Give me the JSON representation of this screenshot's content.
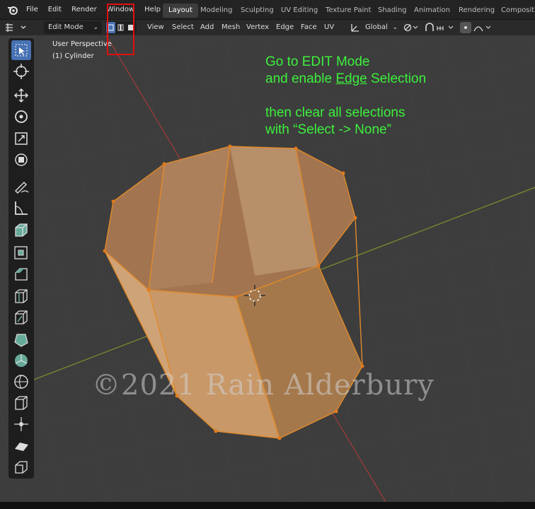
{
  "menu": [
    "File",
    "Edit",
    "Render",
    "Window",
    "Help"
  ],
  "workspaces": [
    "Layout",
    "Modeling",
    "Sculpting",
    "UV Editing",
    "Texture Paint",
    "Shading",
    "Animation",
    "Rendering",
    "Compositing"
  ],
  "mode_select": "Edit Mode",
  "view_menus": [
    "View",
    "Select",
    "Add",
    "Mesh",
    "Vertex",
    "Edge",
    "Face",
    "UV"
  ],
  "transform_orientation": "Global",
  "viewport": {
    "perspective_label": "User Perspective",
    "object_label": "(1) Cylinder"
  },
  "instructions": {
    "line1": "Go to EDIT Mode",
    "line2_prefix": "and enable ",
    "line2_emph": "Edge",
    "line2_suffix": " Selection",
    "line3": "then clear all selections",
    "line4": "with “Select -> None”"
  },
  "watermark": "©2021 Rain Alderbury",
  "colors": {
    "accent": "#4772b3",
    "instruction_green": "#3cf03c",
    "highlight_red": "#e01010",
    "mesh_orange": "#e6a04a"
  }
}
